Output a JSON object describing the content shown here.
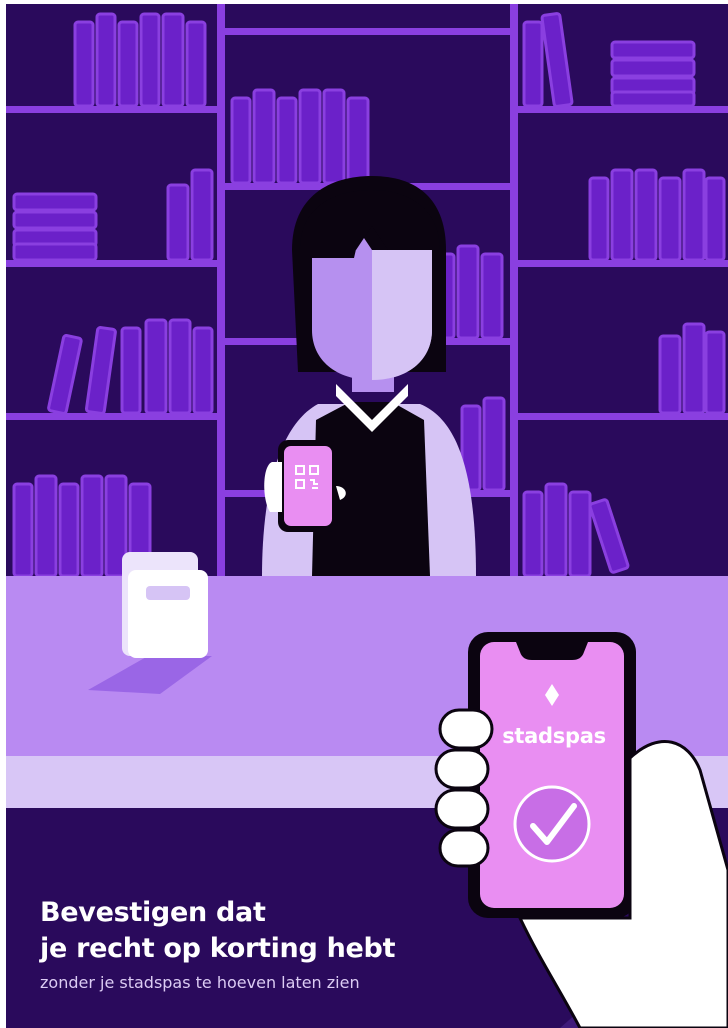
{
  "poster": {
    "headline_line1": "Bevestigen dat",
    "headline_line2": "je recht op korting hebt",
    "subline": "zonder je stadspas te hoeven laten zien"
  },
  "phone": {
    "brand_label": "stadspas",
    "brand_icon": "diamond-icon",
    "status_icon": "checkmark-circle-icon",
    "small_phone_icon": "qr-code-icon"
  },
  "colors": {
    "background_dark": "#2a0a5c",
    "shelf_purple": "#8a3fe0",
    "counter_lilac": "#b98af2",
    "phone_screen": "#e98ef2",
    "text_white": "#ffffff"
  }
}
